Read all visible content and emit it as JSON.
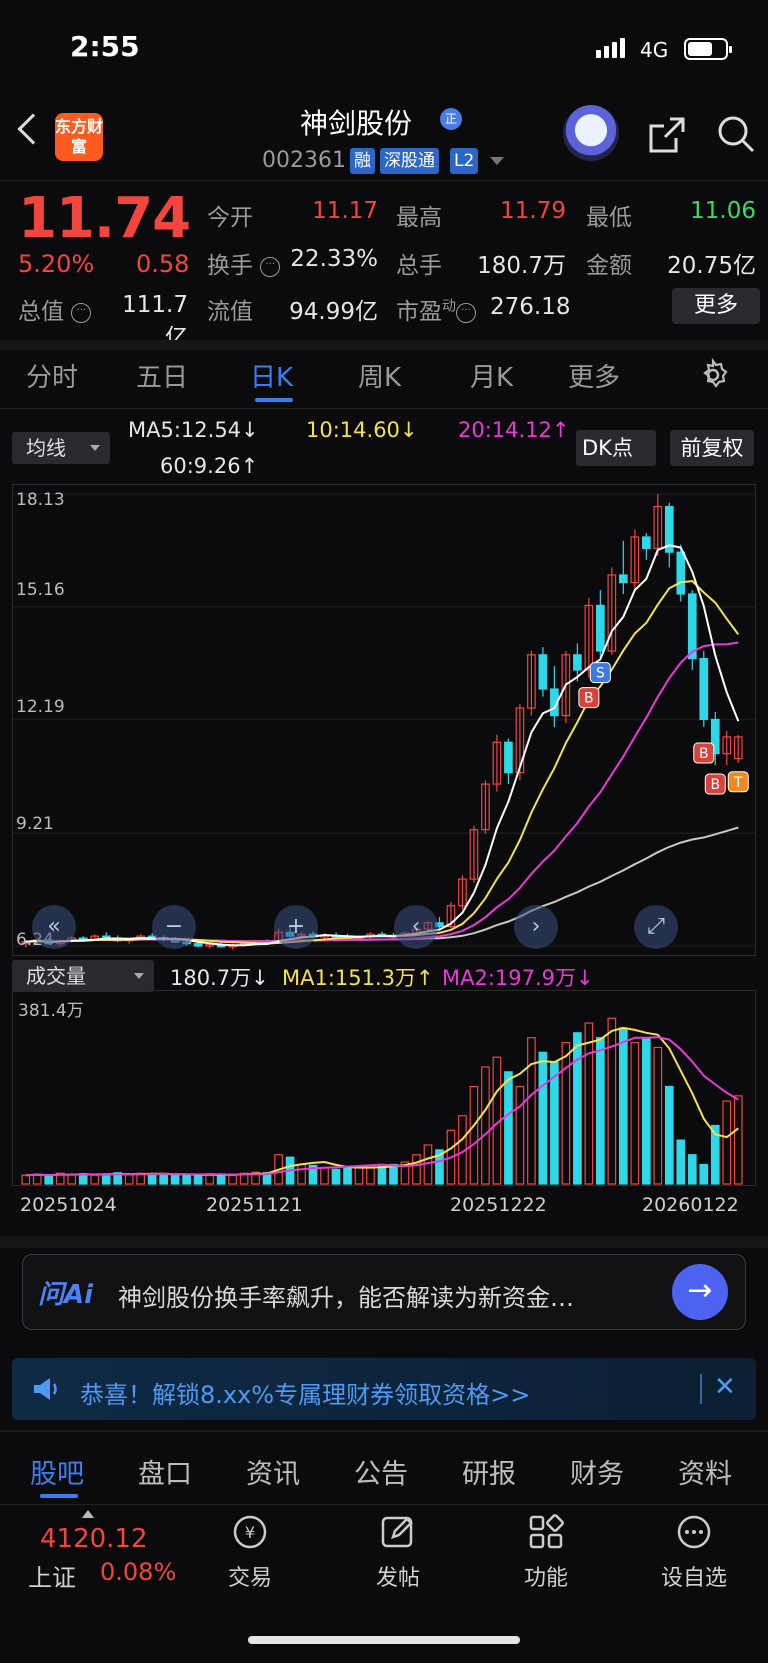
{
  "status": {
    "time": "2:55",
    "network": "4G"
  },
  "header": {
    "logo": "东方财富",
    "stock_name": "神剑股份",
    "badge": "正",
    "code": "002361",
    "tags": [
      "融",
      "深股通",
      "L2"
    ]
  },
  "quote": {
    "price": "11.74",
    "pct": "5.20%",
    "change": "0.58",
    "fields": {
      "open": {
        "label": "今开",
        "value": "11.17"
      },
      "high": {
        "label": "最高",
        "value": "11.79"
      },
      "low": {
        "label": "最低",
        "value": "11.06"
      },
      "turnover": {
        "label": "换手",
        "value": "22.33%"
      },
      "volume": {
        "label": "总手",
        "value": "180.7万"
      },
      "amount": {
        "label": "金额",
        "value": "20.75亿"
      },
      "mktcap": {
        "label": "总值",
        "value": "111.7亿"
      },
      "float": {
        "label": "流值",
        "value": "94.99亿"
      },
      "pe": {
        "label": "市盈",
        "sup": "动",
        "value": "276.18"
      }
    },
    "more_label": "更多"
  },
  "chart_tabs": [
    "分时",
    "五日",
    "日K",
    "周K",
    "月K",
    "更多"
  ],
  "indicators": {
    "ma_button": "均线",
    "ma5": "MA5:12.54",
    "ma10": "10:14.60",
    "ma20": "20:14.12",
    "ma60": "60:9.26",
    "arrow_down": "↓",
    "arrow_up": "↑",
    "dk_button": "DK点",
    "fq_button": "前复权",
    "vol_button": "成交量",
    "vol_value": "180.7万",
    "vol_ma1": "MA1:151.3万",
    "vol_ma2": "MA2:197.9万"
  },
  "chart_data": {
    "type": "candlestick",
    "y_ticks": [
      "18.13",
      "15.16",
      "12.19",
      "9.21",
      "6.24"
    ],
    "ylim": [
      6.24,
      18.13
    ],
    "vol_max_label": "381.4万",
    "vol_max": 381.4,
    "x_dates": [
      "20251024",
      "20251121",
      "20251222",
      "20260122"
    ],
    "colors": {
      "up": "#f2453d",
      "down": "#2ed8e8",
      "ma5": "#ffffff",
      "ma10": "#f5e14a",
      "ma20": "#e83ad8",
      "ma60": "#c8c8c8"
    },
    "markers": [
      "B",
      "S",
      "B",
      "B",
      "T"
    ],
    "candles": [
      [
        6.3,
        6.4,
        6.2,
        6.35
      ],
      [
        6.35,
        6.45,
        6.3,
        6.4
      ],
      [
        6.4,
        6.45,
        6.28,
        6.3
      ],
      [
        6.3,
        6.42,
        6.25,
        6.38
      ],
      [
        6.38,
        6.5,
        6.33,
        6.45
      ],
      [
        6.45,
        6.5,
        6.35,
        6.4
      ],
      [
        6.4,
        6.55,
        6.38,
        6.5
      ],
      [
        6.5,
        6.6,
        6.42,
        6.45
      ],
      [
        6.45,
        6.52,
        6.35,
        6.38
      ],
      [
        6.38,
        6.45,
        6.3,
        6.42
      ],
      [
        6.42,
        6.55,
        6.4,
        6.5
      ],
      [
        6.5,
        6.58,
        6.42,
        6.46
      ],
      [
        6.46,
        6.52,
        6.36,
        6.4
      ],
      [
        6.4,
        6.48,
        6.32,
        6.34
      ],
      [
        6.34,
        6.42,
        6.25,
        6.3
      ],
      [
        6.3,
        6.36,
        6.2,
        6.24
      ],
      [
        6.24,
        6.32,
        6.18,
        6.28
      ],
      [
        6.28,
        6.34,
        6.2,
        6.22
      ],
      [
        6.22,
        6.3,
        6.15,
        6.26
      ],
      [
        6.26,
        6.35,
        6.22,
        6.3
      ],
      [
        6.3,
        6.4,
        6.26,
        6.36
      ],
      [
        6.36,
        6.42,
        6.28,
        6.32
      ],
      [
        6.32,
        6.7,
        6.3,
        6.6
      ],
      [
        6.6,
        6.75,
        6.45,
        6.5
      ],
      [
        6.5,
        6.62,
        6.4,
        6.55
      ],
      [
        6.55,
        6.62,
        6.45,
        6.48
      ],
      [
        6.48,
        6.58,
        6.42,
        6.52
      ],
      [
        6.52,
        6.6,
        6.46,
        6.5
      ],
      [
        6.5,
        6.56,
        6.4,
        6.44
      ],
      [
        6.44,
        6.52,
        6.38,
        6.48
      ],
      [
        6.48,
        6.6,
        6.44,
        6.55
      ],
      [
        6.55,
        6.62,
        6.48,
        6.52
      ],
      [
        6.52,
        6.58,
        6.45,
        6.5
      ],
      [
        6.5,
        6.62,
        6.46,
        6.58
      ],
      [
        6.58,
        6.72,
        6.52,
        6.68
      ],
      [
        6.68,
        6.9,
        6.62,
        6.85
      ],
      [
        6.85,
        7.0,
        6.7,
        6.75
      ],
      [
        6.75,
        7.4,
        6.72,
        7.3
      ],
      [
        7.3,
        8.1,
        7.2,
        8.0
      ],
      [
        8.0,
        9.4,
        7.9,
        9.3
      ],
      [
        9.3,
        10.6,
        9.2,
        10.5
      ],
      [
        10.5,
        11.8,
        10.3,
        11.6
      ],
      [
        11.6,
        11.7,
        10.5,
        10.8
      ],
      [
        10.8,
        12.6,
        10.6,
        12.5
      ],
      [
        12.5,
        14.0,
        12.3,
        13.9
      ],
      [
        13.9,
        14.1,
        12.8,
        13.0
      ],
      [
        13.0,
        13.6,
        12.0,
        12.3
      ],
      [
        12.3,
        14.0,
        12.1,
        13.9
      ],
      [
        13.9,
        14.2,
        13.2,
        13.5
      ],
      [
        13.5,
        15.4,
        13.3,
        15.2
      ],
      [
        15.2,
        15.6,
        13.8,
        14.0
      ],
      [
        14.0,
        16.2,
        13.9,
        16.0
      ],
      [
        16.0,
        16.9,
        15.5,
        15.8
      ],
      [
        15.8,
        17.2,
        15.6,
        17.0
      ],
      [
        17.0,
        17.1,
        16.4,
        16.7
      ],
      [
        16.7,
        18.13,
        16.5,
        17.8
      ],
      [
        17.8,
        17.9,
        16.2,
        16.6
      ],
      [
        16.6,
        16.8,
        15.3,
        15.5
      ],
      [
        15.5,
        15.6,
        13.5,
        13.8
      ],
      [
        13.8,
        14.0,
        12.0,
        12.2
      ],
      [
        12.2,
        12.4,
        11.0,
        11.3
      ],
      [
        11.3,
        11.9,
        11.0,
        11.74
      ],
      [
        11.17,
        11.79,
        11.06,
        11.74
      ]
    ],
    "volumes": [
      18,
      20,
      17,
      22,
      19,
      21,
      18,
      20,
      23,
      19,
      22,
      21,
      20,
      18,
      17,
      19,
      21,
      20,
      18,
      22,
      24,
      23,
      60,
      55,
      40,
      38,
      33,
      30,
      32,
      35,
      38,
      36,
      40,
      45,
      60,
      80,
      70,
      110,
      140,
      200,
      240,
      260,
      230,
      200,
      300,
      270,
      250,
      290,
      310,
      330,
      300,
      340,
      320,
      290,
      300,
      280,
      200,
      90,
      60,
      40,
      120,
      170,
      180.7
    ]
  },
  "ai": {
    "logo": "问Ai",
    "text": "神剑股份换手率飙升，能否解读为新资金…"
  },
  "promo": {
    "text": "恭喜！解锁8.xx%专属理财券领取资格>>"
  },
  "info_tabs": [
    "股吧",
    "盘口",
    "资讯",
    "公告",
    "研报",
    "财务",
    "资料"
  ],
  "bottom_nav": {
    "index_value": "4120.12",
    "index_name": "上证",
    "index_pct": "0.08%",
    "items": [
      "交易",
      "发帖",
      "功能",
      "设自选"
    ]
  }
}
